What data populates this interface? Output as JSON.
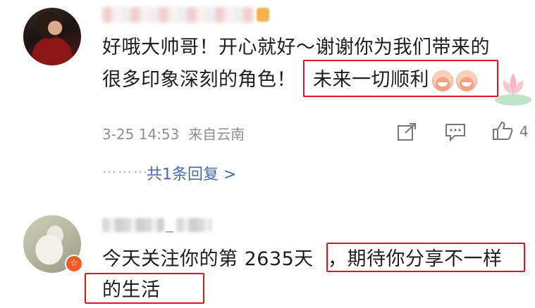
{
  "comments": [
    {
      "text_line1": "好哦大帅哥！开心就好～谢谢你为我们带来的",
      "text_line2_a": "很多印象深刻的角色！",
      "text_line2_b": "未来一切顺利",
      "emoji": [
        "grin-emoji",
        "grin-emoji"
      ],
      "timestamp": "3-25 14:53",
      "source": "来自云南",
      "like_count": "4",
      "replies_link": "共1条回复 >",
      "replies_dots": "⋯⋯⋯"
    },
    {
      "name_suffix": "_",
      "text_line1_a": "今天关注你的第 2635天",
      "text_line1_b": "，期待你分享不一样",
      "text_line2": "的生活",
      "badge_glyph": "☆"
    }
  ],
  "colors": {
    "highlight": "#e0141e",
    "reply_link": "#4a6aa8",
    "meta": "#8f8f8f"
  },
  "icons": [
    "share-icon",
    "comment-icon",
    "like-icon",
    "star-badge-icon"
  ]
}
